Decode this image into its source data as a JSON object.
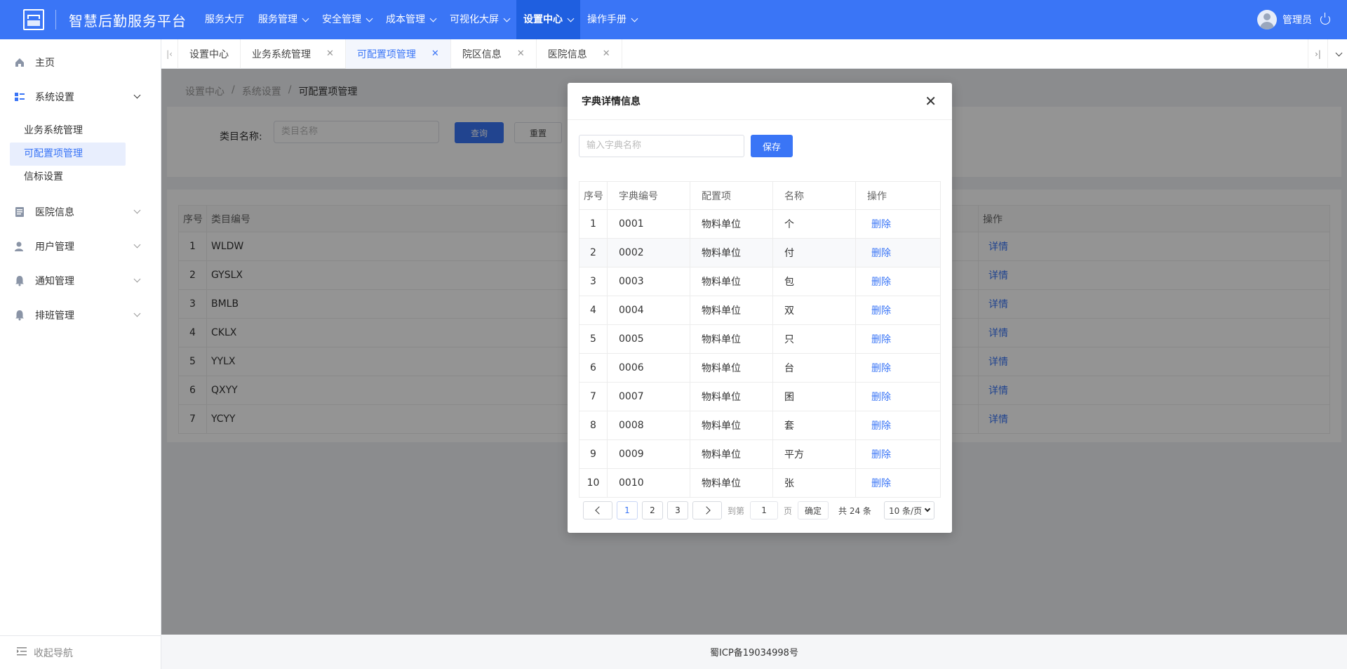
{
  "topnav": {
    "brand": "智慧后勤服务平台",
    "menu": [
      {
        "label": "服务大厅",
        "dropdown": false
      },
      {
        "label": "服务管理",
        "dropdown": true
      },
      {
        "label": "安全管理",
        "dropdown": true
      },
      {
        "label": "成本管理",
        "dropdown": true
      },
      {
        "label": "可视化大屏",
        "dropdown": true
      },
      {
        "label": "设置中心",
        "dropdown": true,
        "active": true
      },
      {
        "label": "操作手册",
        "dropdown": true
      }
    ],
    "user": "管理员"
  },
  "sidebar": {
    "items": [
      {
        "label": "主页",
        "icon": "home-icon"
      },
      {
        "label": "系统设置",
        "icon": "grid-icon"
      },
      {
        "label": "医院信息",
        "icon": "document-icon"
      },
      {
        "label": "用户管理",
        "icon": "user-icon"
      },
      {
        "label": "通知管理",
        "icon": "bell-icon"
      },
      {
        "label": "排班管理",
        "icon": "bell-icon"
      }
    ],
    "sub_items": [
      "业务系统管理",
      "可配置项管理",
      "信标设置"
    ],
    "collapse_label": "收起导航"
  },
  "tabs": [
    {
      "label": "设置中心",
      "closable": false
    },
    {
      "label": "业务系统管理",
      "closable": true
    },
    {
      "label": "可配置项管理",
      "closable": true,
      "active": true
    },
    {
      "label": "院区信息",
      "closable": true
    },
    {
      "label": "医院信息",
      "closable": true
    }
  ],
  "breadcrumb": [
    "设置中心",
    "系统设置",
    "可配置项管理"
  ],
  "search": {
    "label": "类目名称:",
    "placeholder": "类目名称",
    "query_btn": "查询",
    "reset_btn": "重置"
  },
  "bg_table": {
    "headers": [
      "序号",
      "类目编号",
      "操作"
    ],
    "rows": [
      {
        "no": "1",
        "code": "WLDW",
        "op": "详情"
      },
      {
        "no": "2",
        "code": "GYSLX",
        "op": "详情"
      },
      {
        "no": "3",
        "code": "BMLB",
        "op": "详情"
      },
      {
        "no": "4",
        "code": "CKLX",
        "op": "详情"
      },
      {
        "no": "5",
        "code": "YYLX",
        "op": "详情"
      },
      {
        "no": "6",
        "code": "QXYY",
        "op": "详情"
      },
      {
        "no": "7",
        "code": "YCYY",
        "op": "详情"
      }
    ]
  },
  "modal": {
    "title": "字典详情信息",
    "input_placeholder": "输入字典名称",
    "save_btn": "保存",
    "headers": [
      "序号",
      "字典编号",
      "配置项",
      "名称",
      "操作"
    ],
    "rows": [
      {
        "no": "1",
        "code": "0001",
        "item": "物料单位",
        "name": "个",
        "op": "删除"
      },
      {
        "no": "2",
        "code": "0002",
        "item": "物料单位",
        "name": "付",
        "op": "删除"
      },
      {
        "no": "3",
        "code": "0003",
        "item": "物料单位",
        "name": "包",
        "op": "删除"
      },
      {
        "no": "4",
        "code": "0004",
        "item": "物料单位",
        "name": "双",
        "op": "删除"
      },
      {
        "no": "5",
        "code": "0005",
        "item": "物料单位",
        "name": "只",
        "op": "删除"
      },
      {
        "no": "6",
        "code": "0006",
        "item": "物料单位",
        "name": "台",
        "op": "删除"
      },
      {
        "no": "7",
        "code": "0007",
        "item": "物料单位",
        "name": "囷",
        "op": "删除"
      },
      {
        "no": "8",
        "code": "0008",
        "item": "物料单位",
        "name": "套",
        "op": "删除"
      },
      {
        "no": "9",
        "code": "0009",
        "item": "物料单位",
        "name": "平方",
        "op": "删除"
      },
      {
        "no": "10",
        "code": "0010",
        "item": "物料单位",
        "name": "张",
        "op": "删除"
      }
    ],
    "pager": {
      "pages": [
        "1",
        "2",
        "3"
      ],
      "current": "1",
      "goto_label": "到第",
      "goto_value": "1",
      "page_unit": "页",
      "confirm": "确定",
      "total": "共 24 条",
      "page_size": "10 条/页"
    }
  },
  "footer": "蜀ICP备19034998号",
  "colors": {
    "primary": "#3a75f6",
    "nav_active": "#1f5fe0"
  }
}
